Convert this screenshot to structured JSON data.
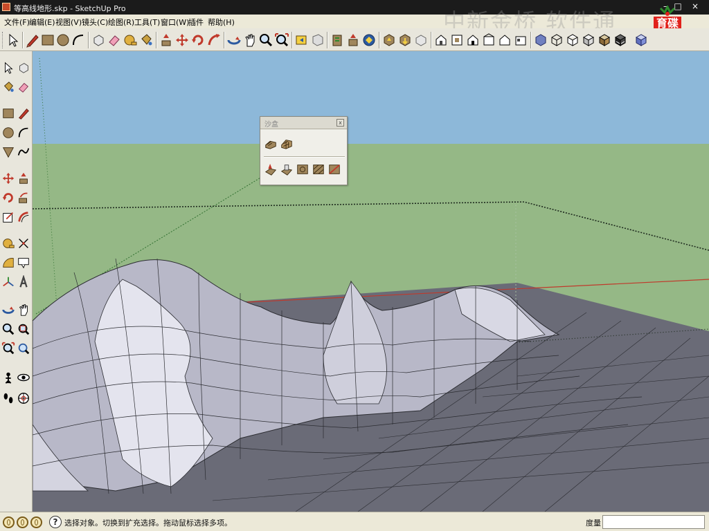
{
  "window": {
    "title": "等高线地形.skp - SketchUp Pro",
    "close_glyph": "×",
    "minimize_glyph": "–",
    "restore_glyph": "□"
  },
  "menu": {
    "items": [
      "文件(F)",
      "编辑(E)",
      "视图(V)",
      "镜头(C)",
      "绘图(R)",
      "工具(T)",
      "窗口(W)",
      "插件",
      "帮助(H)"
    ]
  },
  "watermark": {
    "text": "中新金桥 软件通"
  },
  "logo": {
    "text": "育碟软件"
  },
  "tray": {
    "title": "沙盒",
    "close_glyph": "x"
  },
  "toolbar": {
    "icons": [
      "select-icon",
      "pencil-icon",
      "rectangle-icon",
      "circle-icon",
      "arc-icon",
      "make-component-icon",
      "eraser-icon",
      "tape-measure-icon",
      "paint-bucket-icon",
      "push-pull-icon",
      "move-icon",
      "rotate-icon",
      "follow-me-icon",
      "orbit-icon",
      "pan-icon",
      "zoom-icon",
      "zoom-extents-icon",
      "previous-view-icon",
      "next-view-icon",
      "get-models-icon",
      "share-model-icon",
      "share-component-icon",
      "3d-warehouse-icon",
      "extension-icon",
      "iso-view-icon",
      "top-view-icon",
      "front-view-icon",
      "right-view-icon",
      "back-view-icon",
      "left-view-icon",
      "xray-icon",
      "wireframe-icon",
      "hidden-line-icon",
      "shaded-icon",
      "shaded-textures-icon",
      "monochrome-icon"
    ]
  },
  "left_toolbar": {
    "icons": [
      "select-icon",
      "make-component-icon",
      "paint-bucket-icon",
      "eraser-icon",
      "rectangle-icon",
      "line-icon",
      "circle-icon",
      "arc-icon",
      "polygon-icon",
      "freehand-icon",
      "move-icon",
      "push-pull-icon",
      "rotate-icon",
      "follow-me-icon",
      "scale-icon",
      "offset-icon",
      "tape-measure-icon",
      "dimensions-icon",
      "protractor-icon",
      "text-icon",
      "axes-icon",
      "3d-text-icon",
      "orbit-icon",
      "pan-icon",
      "zoom-icon",
      "zoom-window-icon",
      "zoom-extents-icon",
      "previous-icon",
      "position-camera-icon",
      "look-around-icon",
      "walk-icon",
      "section-plane-icon"
    ]
  },
  "status": {
    "text": "选择对象。切换到扩充选择。拖动鼠标选择多项。",
    "measure_label": "度量",
    "measure_value": ""
  },
  "colors": {
    "sky": "#8db8d9",
    "ground": "#95b886",
    "terrain": "#b8b8c8",
    "terrain_shadow": "#6a6b77",
    "grid": "#2a2b30",
    "red_axis": "#c0392b",
    "green_axis": "#2f8f2f"
  }
}
